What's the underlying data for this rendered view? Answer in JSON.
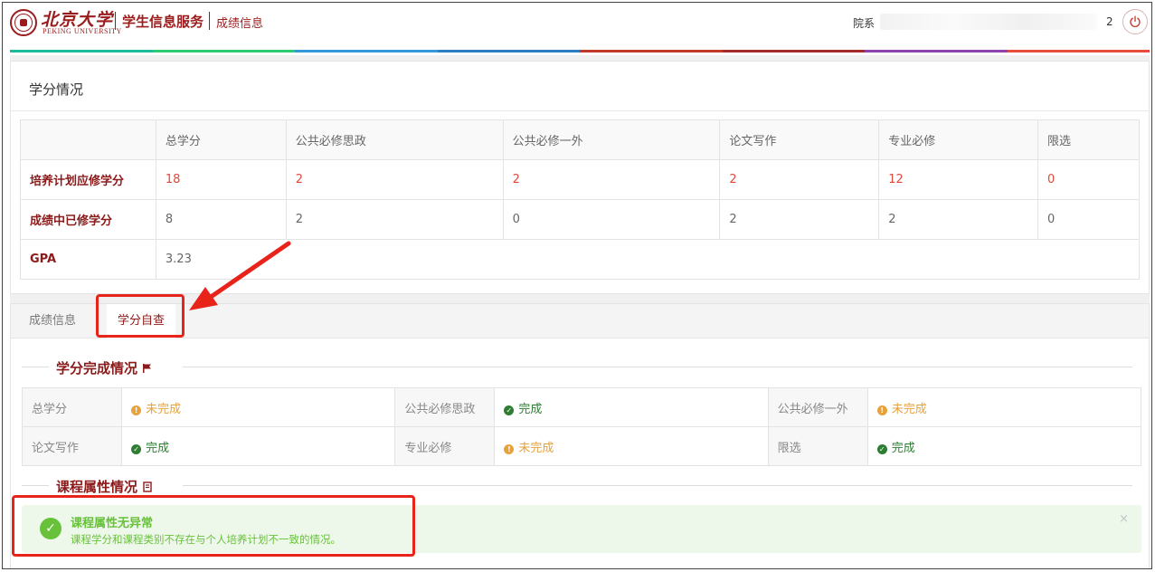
{
  "header": {
    "logo_cn": "北京大学",
    "logo_en": "PEKING UNIVERSITY",
    "app_title": "学生信息服务",
    "page_title": "成绩信息",
    "user_label": "院系",
    "user_num": "2",
    "power_icon": "power-icon"
  },
  "accent_colors": [
    "#1abc9c",
    "#2ecc71",
    "#3498db",
    "#2d7fc1",
    "#c0392b",
    "#a52a2a",
    "#8e44ad",
    "#e74c3c"
  ],
  "credit_panel": {
    "title": "学分情况",
    "columns": [
      "",
      "总学分",
      "公共必修思政",
      "公共必修一外",
      "论文写作",
      "专业必修",
      "限选"
    ],
    "rows": [
      {
        "label": "培养计划应修学分",
        "values": [
          "18",
          "2",
          "2",
          "2",
          "12",
          "0"
        ]
      },
      {
        "label": "成绩中已修学分",
        "values": [
          "8",
          "2",
          "0",
          "2",
          "2",
          "0"
        ]
      },
      {
        "label": "GPA",
        "values": [
          "3.23"
        ]
      }
    ]
  },
  "tabs": [
    {
      "label": "成绩信息",
      "active": false
    },
    {
      "label": "学分自查",
      "active": true
    }
  ],
  "completion": {
    "title": "学分完成情况",
    "flag_icon": "flag-icon",
    "rows": [
      [
        {
          "label": "总学分",
          "status": "未完成",
          "state": "warn"
        },
        {
          "label": "公共必修思政",
          "status": "完成",
          "state": "ok"
        },
        {
          "label": "公共必修一外",
          "status": "未完成",
          "state": "warn"
        }
      ],
      [
        {
          "label": "论文写作",
          "status": "完成",
          "state": "ok"
        },
        {
          "label": "专业必修",
          "status": "未完成",
          "state": "warn"
        },
        {
          "label": "限选",
          "status": "完成",
          "state": "ok"
        }
      ]
    ]
  },
  "course_attr": {
    "title": "课程属性情况",
    "book_icon": "book-icon",
    "alert_title": "课程属性无异常",
    "alert_desc": "课程学分和课程类别不存在与个人培养计划不一致的情况。",
    "close_symbol": "×"
  }
}
